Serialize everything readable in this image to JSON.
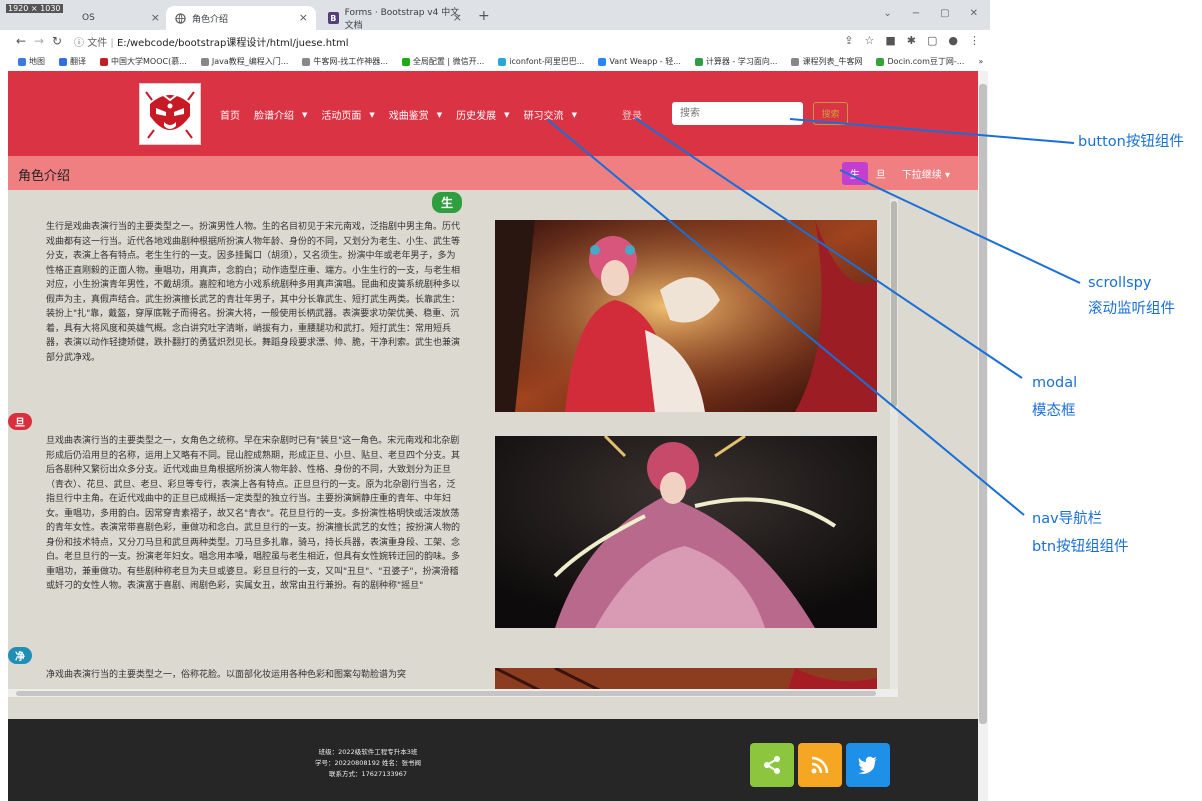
{
  "browser": {
    "resolution_badge": "1920 × 1030",
    "tabs": [
      {
        "label": "OS",
        "close": "×"
      },
      {
        "label": "角色介绍",
        "close": "×"
      },
      {
        "label": "Forms · Bootstrap v4 中文文档",
        "close": "×"
      }
    ],
    "tab3_icon_letter": "B",
    "new_tab": "+",
    "window_controls": [
      "⌄",
      "−",
      "▢",
      "✕"
    ],
    "url_prefix": "文件",
    "url": "E:/webcode/bootstrap课程设计/html/juese.html",
    "bookmarks": [
      {
        "label": "地图",
        "color": "#3b7be0"
      },
      {
        "label": "翻译",
        "color": "#2f6fdf"
      },
      {
        "label": "中国大学MOOC(慕...",
        "color": "#c02020"
      },
      {
        "label": "Java教程_编程入门...",
        "color": "#888888"
      },
      {
        "label": "牛客网-找工作神器...",
        "color": "#888888"
      },
      {
        "label": "全局配置 | 微信开...",
        "color": "#1aad19"
      },
      {
        "label": "iconfont-阿里巴巴...",
        "color": "#2aa7d6"
      },
      {
        "label": "Vant Weapp - 轻...",
        "color": "#2b86f5"
      },
      {
        "label": "计算器 - 学习面向...",
        "color": "#2f9e44"
      },
      {
        "label": "课程列表_牛客网",
        "color": "#888888"
      },
      {
        "label": "Docin.com豆丁网-...",
        "color": "#3aa23a"
      }
    ],
    "bookmarks_more": "»"
  },
  "nav": {
    "items": [
      {
        "label": "首页",
        "caret": ""
      },
      {
        "label": "脸谱介绍",
        "caret": "▼"
      },
      {
        "label": "活动页面",
        "caret": "▼"
      },
      {
        "label": "戏曲鉴赏",
        "caret": "▼"
      },
      {
        "label": "历史发展",
        "caret": "▼"
      },
      {
        "label": "研习交流",
        "caret": "▼"
      }
    ],
    "login": "登录",
    "search_placeholder": "搜索",
    "search_button": "搜索"
  },
  "subbar": {
    "title": "角色介绍",
    "spy": [
      {
        "label": "生",
        "active": true
      },
      {
        "label": "旦",
        "active": false
      },
      {
        "label": "下拉继续 ▾",
        "active": false
      }
    ]
  },
  "sections": {
    "sheng_badge": "生",
    "dan_badge": "旦",
    "jing_badge": "净",
    "sheng_text": "生行是戏曲表演行当的主要类型之一。扮演男性人物。生的名目初见于宋元南戏，泛指剧中男主角。历代戏曲都有这一行当。近代各地戏曲剧种根据所扮演人物年龄、身份的不同，又划分为老生、小生、武生等分支，表演上各有特点。老生生行的一支。因多挂髯口（胡须），又名须生。扮演中年或老年男子，多为性格正直刚毅的正面人物。重唱功，用真声，念韵白；动作造型庄重、端方。小生生行的一支，与老生相对应，小生扮演青年男性，不戴胡须。嘉腔和地方小戏系统剧种多用真声演唱。昆曲和皮簧系统剧种多以假声为主，真假声结合。武生扮演擅长武艺的青壮年男子，其中分长靠武生、短打武生两类。长靠武生：装扮上\"扎\"靠，戴盔，穿厚底靴子而得名。扮演大将，一般使用长柄武器。表演要求功架优美、稳重、沉着，具有大将风度和英雄气概。念白讲究吐字清晰，峭拔有力，重腰腿功和武打。短打武生：常用短兵器，表演以动作轻捷矫健，跌扑翻打的勇猛炽烈见长。舞蹈身段要求漂、帅、脆，干净利索。武生也兼演部分武净戏。",
    "dan_text": "旦戏曲表演行当的主要类型之一，女角色之统称。早在宋杂剧时已有\"装旦\"这一角色。宋元南戏和北杂剧形成后仍沿用旦的名称，运用上又略有不同。昆山腔成熟期，形成正旦、小旦、贴旦、老旦四个分支。其后各剧种又繁衍出众多分支。近代戏曲旦角根据所扮演人物年龄、性格、身份的不同，大致划分为正旦（青衣）、花旦、武旦、老旦、彩旦等专行，表演上各有特点。正旦旦行的一支。原为北杂剧行当名，泛指旦行中主角。在近代戏曲中的正旦已成概括一定类型的独立行当。主要扮演娴静庄重的青年、中年妇女。重唱功，多用韵白。因常穿青素褶子，故又名\"青衣\"。花旦旦行的一支。多扮演性格明快或活泼放荡的青年女性。表演常带喜剧色彩，重做功和念白。武旦旦行的一支。扮演擅长武艺的女性；按扮演人物的身份和技术特点，又分刀马旦和武旦两种类型。刀马旦多扎靠，骑马，持长兵器，表演重身段、工架、念白。老旦旦行的一支。扮演老年妇女。唱念用本嗓，唱腔虽与老生相近，但具有女性婉转迂回的韵味。多重唱功，兼重做功。有些剧种称老旦为夫旦或婆旦。彩旦旦行的一支，又叫\"丑旦\"、\"丑婆子\"，扮演滑稽或奸刁的女性人物。表演富于喜剧、闹剧色彩，实属女丑，故常由丑行兼扮。有的剧种称\"摇旦\"",
    "jing_text": "净戏曲表演行当的主要类型之一，俗称花脸。以面部化妆运用各种色彩和图案勾勒脸谱为突"
  },
  "footer": {
    "class_line": "班级：2022级软件工程专升本3班",
    "id_line": "学号：20220808192 姓名：张书阀",
    "contact_line": "联系方式：17627133967"
  },
  "annotations": {
    "button": "button按钮组件",
    "scrollspy_1": "scrollspy",
    "scrollspy_2": "滚动监听组件",
    "modal_1": "modal",
    "modal_2": "模态框",
    "nav_1": "nav导航栏",
    "nav_2": "btn按钮组组件"
  },
  "colors": {
    "navbar": "#d93344",
    "subbar": "#f07f82",
    "spy_active": "#c23fd0",
    "annotation": "#1a6fd6",
    "share": "#8cc63f",
    "rss": "#f5a623",
    "twitter": "#1e90e8"
  },
  "icons": {
    "share": "share-icon",
    "rss": "rss-icon",
    "twitter": "twitter-icon"
  }
}
